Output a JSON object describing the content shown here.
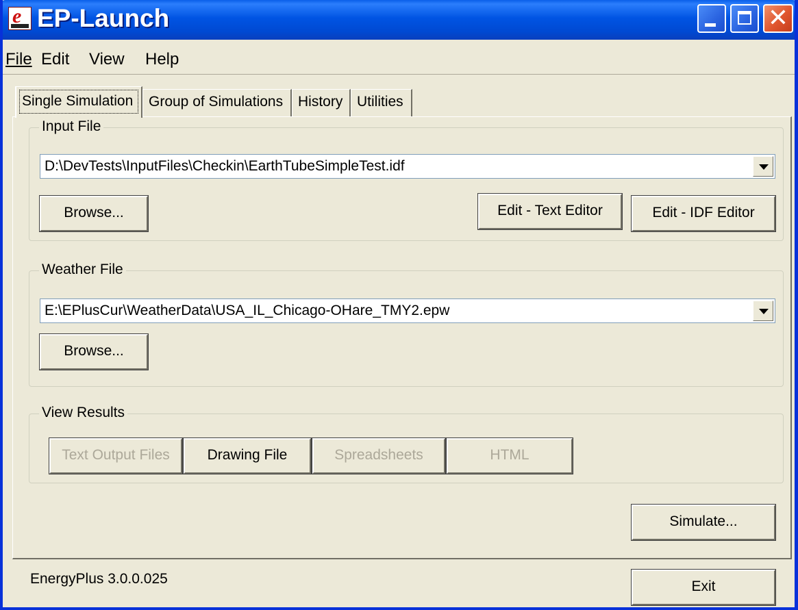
{
  "window": {
    "title": "EP-Launch"
  },
  "menu": [
    "File",
    "Edit",
    "View",
    "Help"
  ],
  "tabs": [
    "Single Simulation",
    "Group of Simulations",
    "History",
    "Utilities"
  ],
  "active_tab": "Single Simulation",
  "input_file": {
    "label": "Input File",
    "value": "D:\\DevTests\\InputFiles\\Checkin\\EarthTubeSimpleTest.idf",
    "browse_label": "Browse...",
    "edit_text_label": "Edit - Text Editor",
    "edit_idf_label": "Edit - IDF Editor"
  },
  "weather_file": {
    "label": "Weather File",
    "value": "E:\\EPlusCur\\WeatherData\\USA_IL_Chicago-OHare_TMY2.epw",
    "browse_label": "Browse..."
  },
  "view_results": {
    "label": "View Results",
    "text_output_label": "Text Output Files",
    "drawing_file_label": "Drawing File",
    "spreadsheets_label": "Spreadsheets",
    "html_label": "HTML"
  },
  "simulate_label": "Simulate...",
  "status_text": "EnergyPlus 3.0.0.025",
  "exit_label": "Exit",
  "colors": {
    "titlebar": "#0054e3",
    "face": "#ece9d8",
    "close": "#e0562f",
    "disabled_text": "#aca899"
  }
}
